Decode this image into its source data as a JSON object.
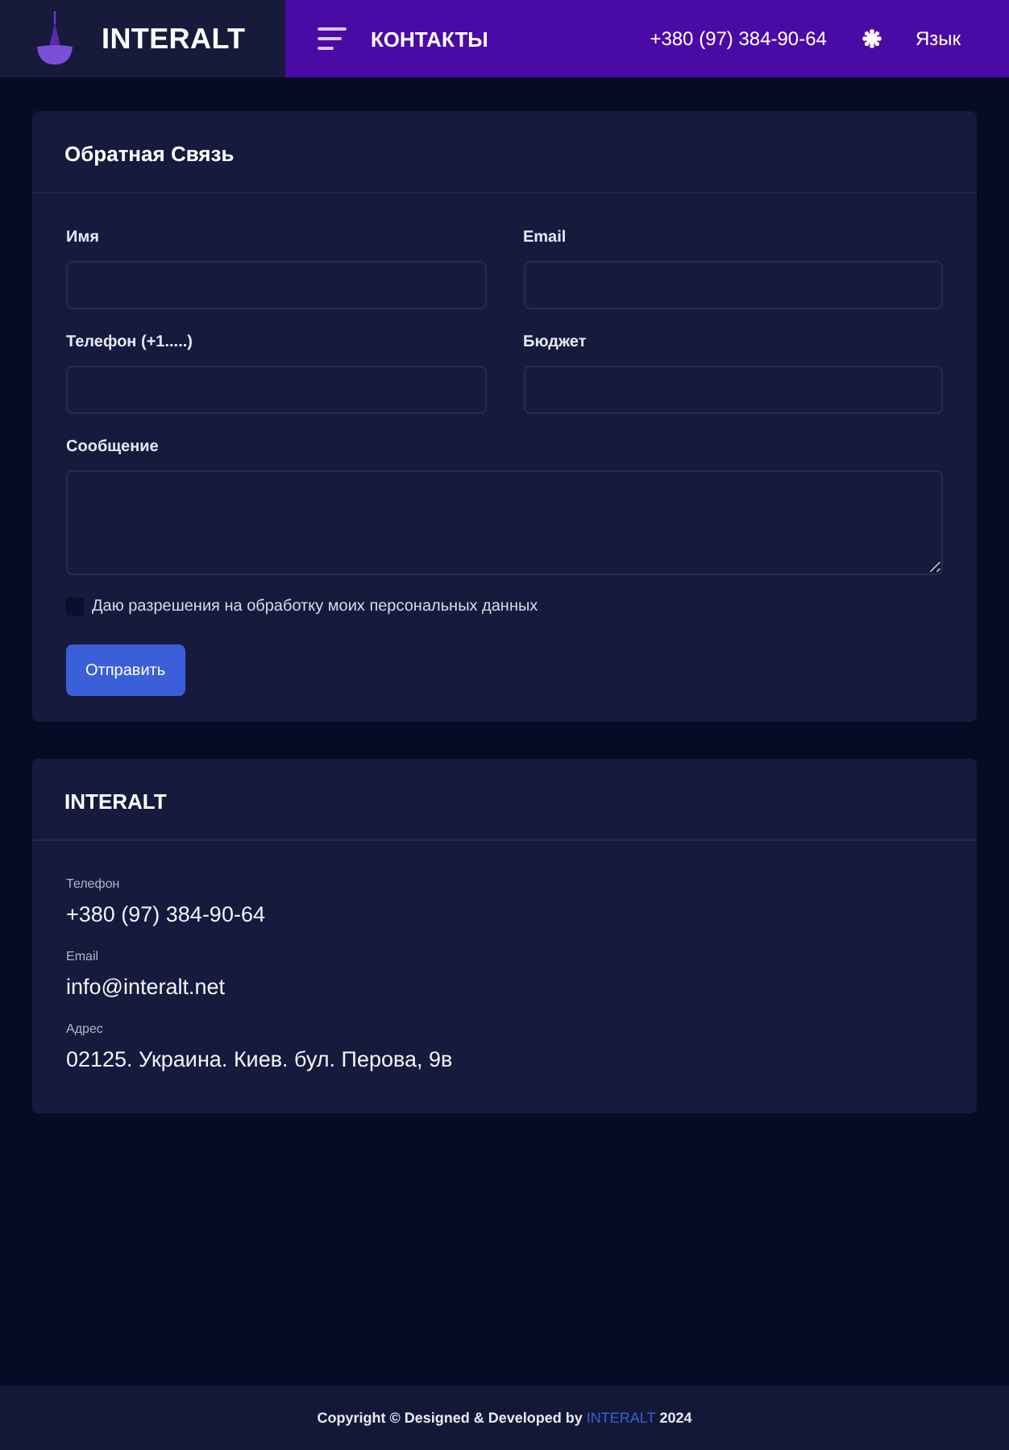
{
  "header": {
    "brand": "INTERALT",
    "nav_label": "КОНТАКТЫ",
    "phone": "+380 (97) 384-90-64",
    "language": "Язык"
  },
  "feedback_form": {
    "title": "Обратная Связь",
    "fields": [
      {
        "label": "Имя",
        "kind": "input"
      },
      {
        "label": "Email",
        "kind": "input"
      },
      {
        "label": "Телефон (+1.....)",
        "kind": "input"
      },
      {
        "label": "Бюджет",
        "kind": "input"
      },
      {
        "label": "Сообщение",
        "kind": "textarea"
      }
    ],
    "consent": {
      "label": "Даю разрешения на обработку моих персональных данных",
      "checked": false
    },
    "submit": "Отправить"
  },
  "contacts_card": {
    "title": "INTERALT",
    "items": [
      {
        "label": "Телефон",
        "value": "+380 (97) 384-90-64"
      },
      {
        "label": "Email",
        "value": "info@interalt.net"
      },
      {
        "label": "Адрес",
        "value": "02125. Украина. Киев. бул. Перова, 9в"
      }
    ]
  },
  "footer": {
    "text_before": "Copyright © Designed & Developed by",
    "link": "INTERALT",
    "text_after": "2024"
  }
}
